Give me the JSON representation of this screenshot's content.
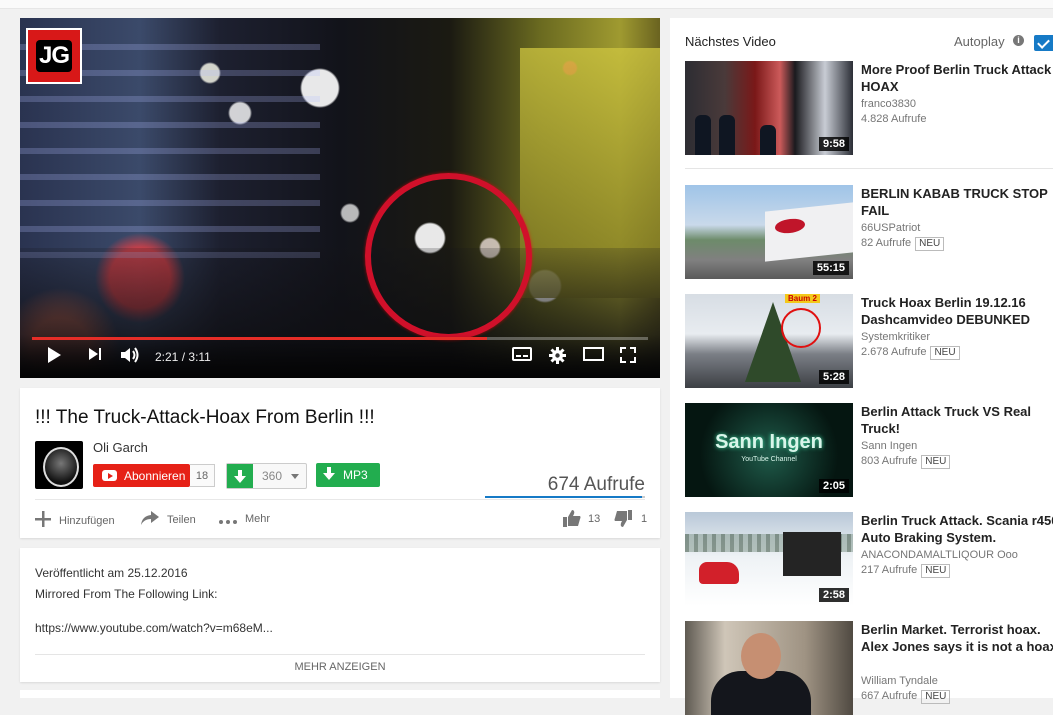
{
  "player": {
    "logo_text": "JG",
    "time_current": "2:21",
    "time_separator": "/",
    "time_total": "3:11",
    "progress": 0.738,
    "accent_color": "#e52d27"
  },
  "video": {
    "title": "!!! The Truck-Attack-Hoax From Berlin !!!",
    "channel": "Oli Garch",
    "subscribe_label": "Abonnieren",
    "subscriber_count": "18",
    "download_count": "360",
    "mp3_label": "MP3",
    "views": "674 Aufrufe",
    "add_label": "Hinzufügen",
    "share_label": "Teilen",
    "more_label": "Mehr",
    "likes": "13",
    "dislikes": "1"
  },
  "description": {
    "published": "Veröffentlicht am 25.12.2016",
    "line1": "Mirrored From The Following Link:",
    "link": "https://www.youtube.com/watch?v=m68eM...",
    "show_more": "MEHR ANZEIGEN"
  },
  "sidebar": {
    "up_next_label": "Nächstes Video",
    "autoplay_label": "Autoplay",
    "autoplay_on": true,
    "videos": [
      {
        "title": "More Proof Berlin Truck Attack HOAX",
        "channel": "franco3830",
        "views": "4.828 Aufrufe",
        "badge": "",
        "duration": "9:58"
      },
      {
        "title": "BERLIN KABAB TRUCK STOP FAIL",
        "channel": "66USPatriot",
        "views": "82 Aufrufe",
        "badge": "NEU",
        "duration": "55:15"
      },
      {
        "title": "Truck Hoax Berlin 19.12.16 Dashcamvideo DEBUNKED",
        "channel": "Systemkritiker",
        "views": "2.678 Aufrufe",
        "badge": "NEU",
        "duration": "5:28",
        "thumb_label": "Baum 2"
      },
      {
        "title": "Berlin Attack Truck VS Real Truck!",
        "channel": "Sann Ingen",
        "views": "803 Aufrufe",
        "badge": "NEU",
        "duration": "2:05",
        "thumb_text": "Sann Ingen",
        "thumb_sub": "YouTube Channel"
      },
      {
        "title": "Berlin Truck Attack. Scania r450 Auto Braking System.",
        "channel": "ANACONDAMALTLIQOUR Ooo",
        "views": "217 Aufrufe",
        "badge": "NEU",
        "duration": "2:58"
      },
      {
        "title": "Berlin Market. Terrorist hoax. Alex Jones says it is not a hoax",
        "channel": "William Tyndale",
        "views": "667 Aufrufe",
        "badge": "NEU",
        "duration": ""
      }
    ]
  }
}
